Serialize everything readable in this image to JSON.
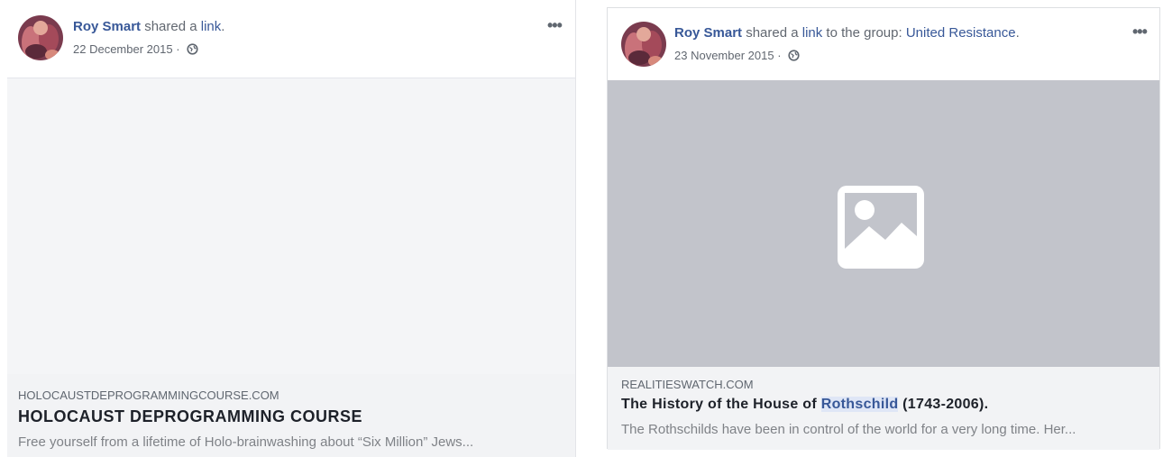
{
  "posts": [
    {
      "author": "Roy Smart",
      "action_prefix": "shared a ",
      "action_link": "link",
      "action_suffix": ".",
      "date": "22 December 2015",
      "date_sep": " · ",
      "more_label": "•••",
      "privacy_icon": "globe-icon",
      "link_preview": {
        "domain": "HOLOCAUSTDEPROGRAMMINGCOURSE.COM",
        "title": "HOLOCAUST DEPROGRAMMING COURSE",
        "description": "Free yourself from a lifetime of Holo-brainwashing about “Six Million” Jews...",
        "image": "blank"
      }
    },
    {
      "author": "Roy Smart",
      "action_prefix": "shared a ",
      "action_link": "link",
      "action_middle": " to the group: ",
      "group": "United Resistance",
      "action_suffix": ".",
      "date": "23 November 2015",
      "date_sep": " · ",
      "more_label": "•••",
      "privacy_icon": "globe-icon",
      "link_preview": {
        "domain": "REALITIESWATCH.COM",
        "title_before": "The History of the House of ",
        "title_highlight": "Rothschild",
        "title_after": " (1743-2006).",
        "description": "The Rothschilds have been in control of the world for a very long time. Her...",
        "image": "image-placeholder-icon"
      }
    }
  ],
  "colors": {
    "link": "#385898",
    "meta_text": "#616770",
    "caption_bg": "#f2f3f5",
    "placeholder_bg": "#c2c4cb",
    "highlight_bg": "#dfe6f6"
  }
}
